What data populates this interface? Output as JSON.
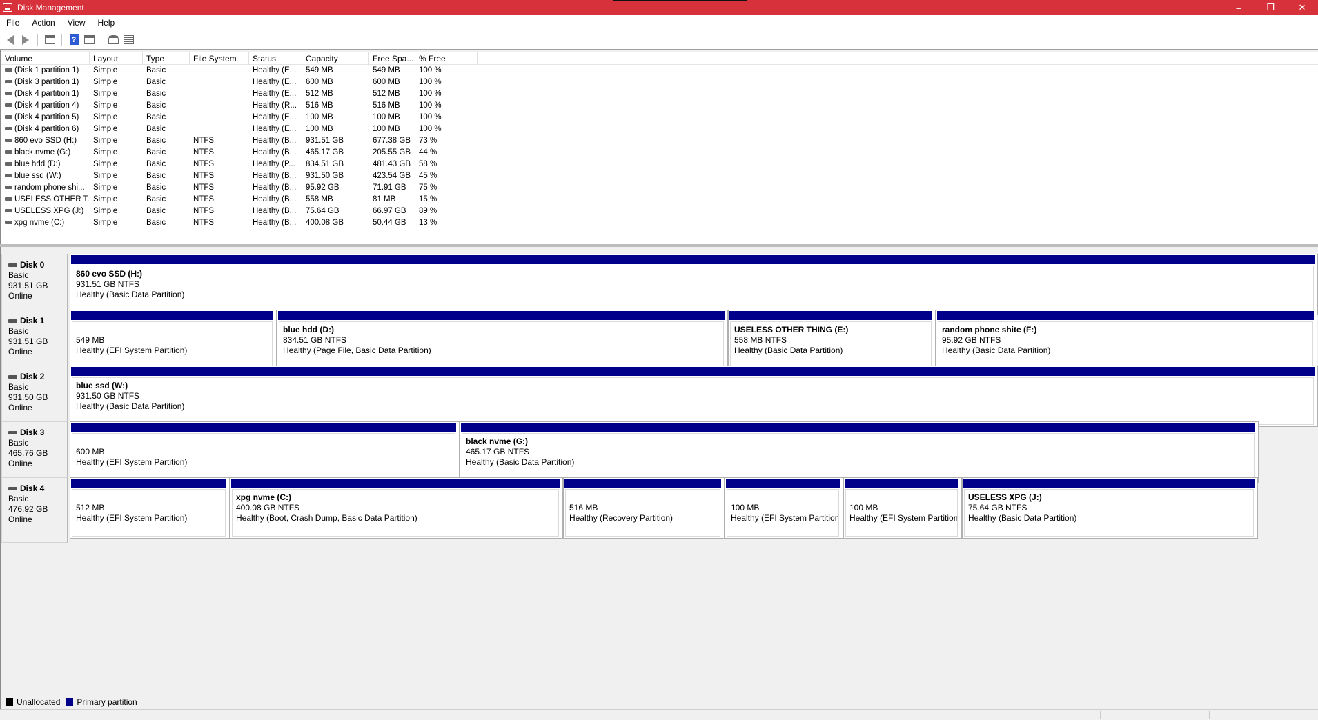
{
  "window": {
    "title": "Disk Management",
    "minimize_icon": "minimize-icon",
    "restore_icon": "restore-icon",
    "close_icon": "close-icon"
  },
  "menu": [
    "File",
    "Action",
    "View",
    "Help"
  ],
  "toolbar_icons": [
    "back-arrow-icon",
    "forward-arrow-icon",
    "console-tree-icon",
    "help-icon",
    "properties-icon",
    "rescan-icon",
    "list-view-icon"
  ],
  "volume_list": {
    "columns": [
      "Volume",
      "Layout",
      "Type",
      "File System",
      "Status",
      "Capacity",
      "Free Spa...",
      "% Free"
    ],
    "rows": [
      [
        "(Disk 1 partition 1)",
        "Simple",
        "Basic",
        "",
        "Healthy (E...",
        "549 MB",
        "549 MB",
        "100 %"
      ],
      [
        "(Disk 3 partition 1)",
        "Simple",
        "Basic",
        "",
        "Healthy (E...",
        "600 MB",
        "600 MB",
        "100 %"
      ],
      [
        "(Disk 4 partition 1)",
        "Simple",
        "Basic",
        "",
        "Healthy (E...",
        "512 MB",
        "512 MB",
        "100 %"
      ],
      [
        "(Disk 4 partition 4)",
        "Simple",
        "Basic",
        "",
        "Healthy (R...",
        "516 MB",
        "516 MB",
        "100 %"
      ],
      [
        "(Disk 4 partition 5)",
        "Simple",
        "Basic",
        "",
        "Healthy (E...",
        "100 MB",
        "100 MB",
        "100 %"
      ],
      [
        "(Disk 4 partition 6)",
        "Simple",
        "Basic",
        "",
        "Healthy (E...",
        "100 MB",
        "100 MB",
        "100 %"
      ],
      [
        "860 evo SSD (H:)",
        "Simple",
        "Basic",
        "NTFS",
        "Healthy (B...",
        "931.51 GB",
        "677.38 GB",
        "73 %"
      ],
      [
        "black nvme (G:)",
        "Simple",
        "Basic",
        "NTFS",
        "Healthy (B...",
        "465.17 GB",
        "205.55 GB",
        "44 %"
      ],
      [
        "blue hdd (D:)",
        "Simple",
        "Basic",
        "NTFS",
        "Healthy (P...",
        "834.51 GB",
        "481.43 GB",
        "58 %"
      ],
      [
        "blue ssd (W:)",
        "Simple",
        "Basic",
        "NTFS",
        "Healthy (B...",
        "931.50 GB",
        "423.54 GB",
        "45 %"
      ],
      [
        "random phone shi...",
        "Simple",
        "Basic",
        "NTFS",
        "Healthy (B...",
        "95.92 GB",
        "71.91 GB",
        "75 %"
      ],
      [
        "USELESS OTHER T...",
        "Simple",
        "Basic",
        "NTFS",
        "Healthy (B...",
        "558 MB",
        "81 MB",
        "15 %"
      ],
      [
        "USELESS XPG (J:)",
        "Simple",
        "Basic",
        "NTFS",
        "Healthy (B...",
        "75.64 GB",
        "66.97 GB",
        "89 %"
      ],
      [
        "xpg nvme (C:)",
        "Simple",
        "Basic",
        "NTFS",
        "Healthy (B...",
        "400.08 GB",
        "50.44 GB",
        "13 %"
      ]
    ]
  },
  "disks": [
    {
      "name": "Disk 0",
      "type": "Basic",
      "size": "931.51 GB",
      "state": "Online",
      "partitions": [
        {
          "name": "860 evo SSD  (H:)",
          "size": "931.51 GB NTFS",
          "status": "Healthy (Basic Data Partition)",
          "share": 1.0
        }
      ]
    },
    {
      "name": "Disk 1",
      "type": "Basic",
      "size": "931.51 GB",
      "state": "Online",
      "partitions": [
        {
          "name": "",
          "size": "549 MB",
          "status": "Healthy (EFI System Partition)",
          "share": 0.1659
        },
        {
          "name": "blue hdd  (D:)",
          "size": "834.51 GB NTFS",
          "status": "Healthy (Page File, Basic Data Partition)",
          "share": 0.3617
        },
        {
          "name": "USELESS OTHER THING  (E:)",
          "size": "558 MB NTFS",
          "status": "Healthy (Basic Data Partition)",
          "share": 0.1665
        },
        {
          "name": "random phone shite  (F:)",
          "size": "95.92 GB NTFS",
          "status": "Healthy (Basic Data Partition)",
          "share": 0.3059
        }
      ]
    },
    {
      "name": "Disk 2",
      "type": "Basic",
      "size": "931.50 GB",
      "state": "Online",
      "partitions": [
        {
          "name": "blue ssd  (W:)",
          "size": "931.50 GB NTFS",
          "status": "Healthy (Basic Data Partition)",
          "share": 1.0
        }
      ]
    },
    {
      "name": "Disk 3",
      "type": "Basic",
      "size": "465.76 GB",
      "state": "Online",
      "partitions": [
        {
          "name": "",
          "size": "600 MB",
          "status": "Healthy (EFI System Partition)",
          "share": 0.3277
        },
        {
          "name": "black nvme  (G:)",
          "size": "465.17 GB NTFS",
          "status": "Healthy (Basic Data Partition)",
          "share": 0.6723
        }
      ]
    },
    {
      "name": "Disk 4",
      "type": "Basic",
      "size": "476.92 GB",
      "state": "Online",
      "partitions": [
        {
          "name": "",
          "size": "512 MB",
          "status": "Healthy (EFI System Partition)",
          "share": 0.1345
        },
        {
          "name": "xpg nvme  (C:)",
          "size": "400.08 GB NTFS",
          "status": "Healthy (Boot, Crash Dump, Basic Data Partition)",
          "share": 0.2806
        },
        {
          "name": "",
          "size": "516 MB",
          "status": "Healthy (Recovery Partition)",
          "share": 0.1359
        },
        {
          "name": "",
          "size": "100 MB",
          "status": "Healthy (EFI System Partition)",
          "share": 0.1
        },
        {
          "name": "",
          "size": "100 MB",
          "status": "Healthy (EFI System Partition)",
          "share": 0.1
        },
        {
          "name": "USELESS XPG  (J:)",
          "size": "75.64 GB NTFS",
          "status": "Healthy (Basic Data Partition)",
          "share": 0.249
        }
      ]
    }
  ],
  "legend": [
    {
      "label": "Unallocated",
      "color": "#000000"
    },
    {
      "label": "Primary partition",
      "color": "#00008b"
    }
  ],
  "colors": {
    "titlebar": "#d7313b",
    "partition_bar": "#00008b"
  }
}
